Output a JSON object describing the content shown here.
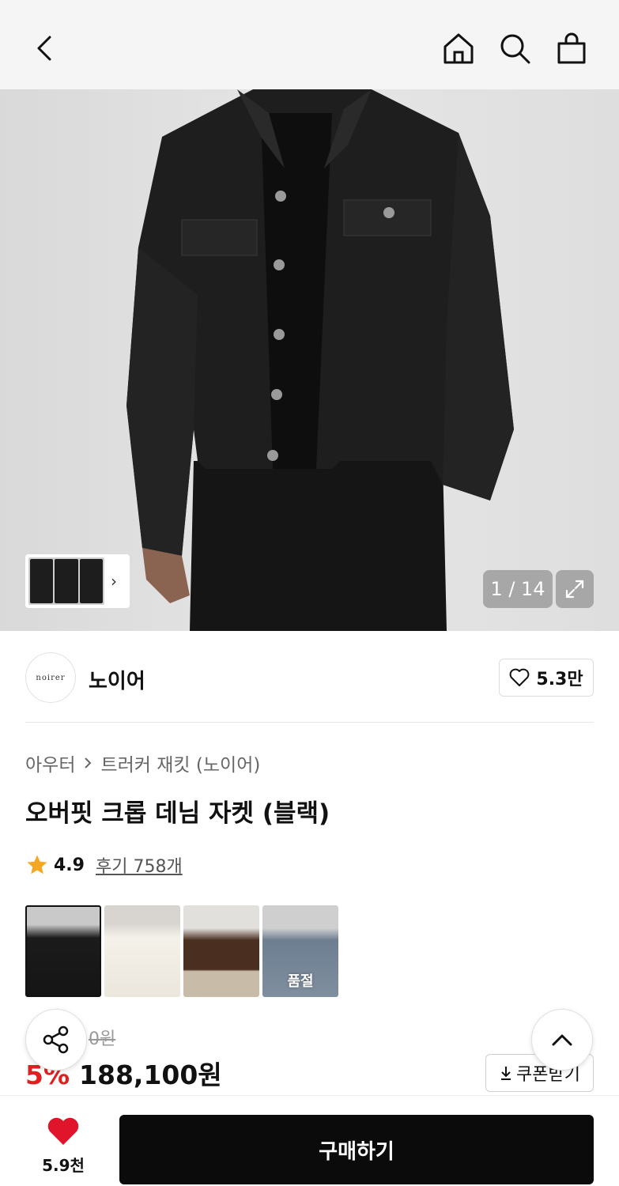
{
  "header": {
    "back_icon": "chevron-left-icon",
    "home_icon": "home-icon",
    "search_icon": "search-icon",
    "cart_icon": "shopping-bag-icon"
  },
  "gallery": {
    "counter": "1 / 14",
    "expand_icon": "expand-icon",
    "thumb_chevron": "›"
  },
  "brand": {
    "logo_text": "noirer",
    "name": "노이어",
    "likes": "5.3만"
  },
  "product": {
    "breadcrumb": [
      "아우터",
      "트러커 재킷 (노이어)"
    ],
    "title": "오버핏 크롭 데님 자켓 (블랙)",
    "rating": "4.9",
    "reviews": "후기 758개",
    "color_options": [
      {
        "label": "black denim",
        "selected": true,
        "soldout": ""
      },
      {
        "label": "white",
        "selected": false,
        "soldout": ""
      },
      {
        "label": "brown",
        "selected": false,
        "soldout": ""
      },
      {
        "label": "light blue denim",
        "selected": false,
        "soldout": "품절"
      }
    ],
    "original_price": "0원",
    "discount": "5%",
    "price": "188,100원",
    "coupon_label": "쿠폰받기"
  },
  "bottom_bar": {
    "wish_count": "5.9천",
    "buy_label": "구매하기"
  },
  "colors": {
    "accent_red": "#e02020",
    "buy_bg": "#0b0b0b",
    "star": "#f5a623"
  }
}
